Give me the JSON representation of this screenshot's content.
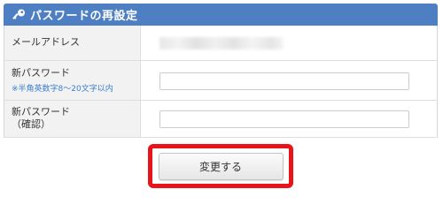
{
  "header": {
    "title": "パスワードの再設定",
    "icon": "key-icon",
    "color": "#4f7fc3"
  },
  "rows": [
    {
      "label": "メールアドレス",
      "value_note": "blurred"
    },
    {
      "label": "新パスワード",
      "note": "※半角英数字8〜20文字以内",
      "value": ""
    },
    {
      "label_line1": "新パスワード",
      "label_line2": "（確認）",
      "value": ""
    }
  ],
  "submit": {
    "label": "変更する",
    "highlight_color": "#e8141a"
  }
}
